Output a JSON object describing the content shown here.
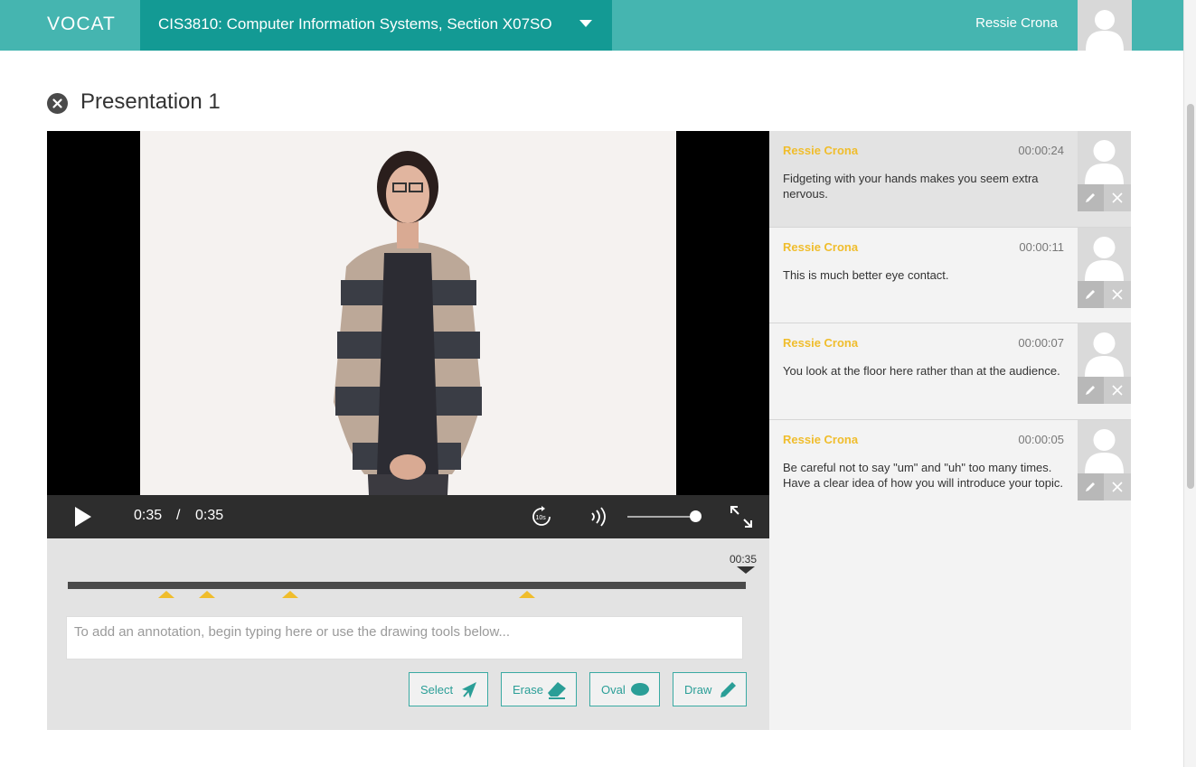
{
  "header": {
    "logo": "VOCAT",
    "course": "CIS3810: Computer Information Systems, Section X07SO",
    "user_name": "Ressie Crona"
  },
  "page": {
    "title": "Presentation 1"
  },
  "player": {
    "current_time": "0:35",
    "separator": "/",
    "duration": "0:35",
    "replay_label": "10s",
    "volume_level": 0.9
  },
  "timeline": {
    "marker_time": "00:35"
  },
  "annotation_input": {
    "placeholder": "To add an annotation, begin typing here or use the drawing tools below..."
  },
  "tools": [
    {
      "label": "Select",
      "icon": "select-arrow-icon"
    },
    {
      "label": "Erase",
      "icon": "eraser-icon"
    },
    {
      "label": "Oval",
      "icon": "oval-icon"
    },
    {
      "label": "Draw",
      "icon": "pencil-icon"
    }
  ],
  "comments": [
    {
      "author": "Ressie Crona",
      "time": "00:00:24",
      "text": "Fidgeting with your hands makes you seem extra nervous."
    },
    {
      "author": "Ressie Crona",
      "time": "00:00:11",
      "text": "This is much better eye contact."
    },
    {
      "author": "Ressie Crona",
      "time": "00:00:07",
      "text": "You look at the floor here rather than at the audience."
    },
    {
      "author": "Ressie Crona",
      "time": "00:00:05",
      "text": "Be careful not to say \"um\" and \"uh\" too many times. Have a clear idea of how you will introduce your topic."
    }
  ],
  "colors": {
    "header": "#45b5b0",
    "course_bg": "#139a94",
    "accent": "#f0bd2c",
    "tool_border": "#3aaaa3"
  }
}
